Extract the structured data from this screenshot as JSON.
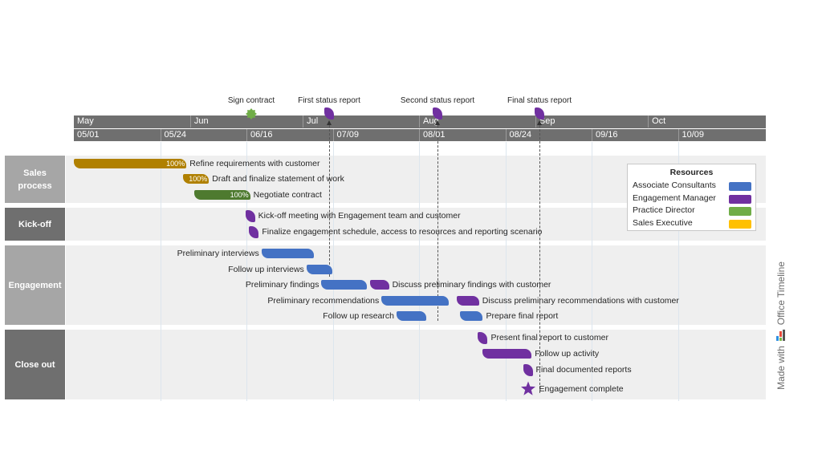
{
  "chart_data": {
    "type": "gantt",
    "title": "",
    "scale": {
      "months": [
        "May",
        "Jun",
        "Jul",
        "Aug",
        "Sep",
        "Oct"
      ],
      "ticks": [
        "05/01",
        "05/24",
        "06/16",
        "07/09",
        "08/01",
        "08/24",
        "09/16",
        "10/09"
      ]
    },
    "milestones_top": [
      {
        "label": "Sign contract",
        "date": "06/17",
        "resource": "Practice Director",
        "shape": "burst"
      },
      {
        "label": "First status report",
        "date": "07/06",
        "resource": "Engagement Manager",
        "shape": "leaf"
      },
      {
        "label": "Second status report",
        "date": "08/01",
        "resource": "Engagement Manager",
        "shape": "leaf"
      },
      {
        "label": "Final status report",
        "date": "08/30",
        "resource": "Engagement Manager",
        "shape": "leaf"
      }
    ],
    "swimlanes": [
      {
        "name": "Sales\nprocess",
        "tasks": [
          {
            "label": "Refine requirements with customer",
            "start": "05/01",
            "end": "05/31",
            "resource": "Sales Executive",
            "percent": "100%"
          },
          {
            "label": "Draft and finalize statement of work",
            "start": "05/30",
            "end": "06/06",
            "resource": "Sales Executive",
            "percent": "100%"
          },
          {
            "label": "Negotiate contract",
            "start": "06/02",
            "end": "06/17",
            "resource": "Practice Director",
            "percent": "100%"
          }
        ]
      },
      {
        "name": "Kick-off",
        "tasks": [
          {
            "label": "Kick-off meeting with Engagement team and customer",
            "start": "06/17",
            "resource": "Engagement Manager",
            "milestone": true
          },
          {
            "label": "Finalize engagement schedule, access to resources and reporting scenario",
            "start": "06/18",
            "resource": "Engagement Manager",
            "milestone": true
          }
        ]
      },
      {
        "name": "Engagement",
        "tasks": [
          {
            "label": "Preliminary interviews",
            "start": "06/20",
            "end": "07/04",
            "resource": "Associate Consultants",
            "label_side": "left"
          },
          {
            "label": "Follow up interviews",
            "start": "07/02",
            "end": "07/09",
            "resource": "Associate Consultants",
            "label_side": "left"
          },
          {
            "label": "Preliminary findings",
            "start": "07/06",
            "end": "07/18",
            "resource": "Associate Consultants",
            "label_side": "left"
          },
          {
            "label": "Discuss preliminary findings with customer",
            "start": "07/19",
            "end": "07/24",
            "resource": "Engagement Manager"
          },
          {
            "label": "Preliminary recommendations",
            "start": "07/22",
            "end": "08/09",
            "resource": "Associate Consultants",
            "label_side": "left"
          },
          {
            "label": "Discuss preliminary recommendations with customer",
            "start": "08/11",
            "end": "08/17",
            "resource": "Engagement Manager"
          },
          {
            "label": "Follow up research",
            "start": "07/26",
            "end": "08/03",
            "resource": "Associate Consultants",
            "label_side": "left"
          },
          {
            "label": "Prepare final report",
            "start": "08/12",
            "end": "08/18",
            "resource": "Associate Consultants"
          }
        ]
      },
      {
        "name": "Close out",
        "tasks": [
          {
            "label": "Present final report to customer",
            "start": "08/18",
            "resource": "Engagement Manager",
            "milestone": true
          },
          {
            "label": "Follow up activity",
            "start": "08/18",
            "end": "08/31",
            "resource": "Engagement Manager"
          },
          {
            "label": "Final documented reports",
            "start": "08/30",
            "resource": "Engagement Manager",
            "milestone": true
          },
          {
            "label": "Engagement complete",
            "start": "08/30",
            "resource": "Engagement Manager",
            "milestone": true,
            "shape": "star"
          }
        ]
      }
    ],
    "legend": {
      "title": "Resources",
      "placement": "right",
      "items": [
        {
          "label": "Associate Consultants",
          "color": "#4472c4"
        },
        {
          "label": "Engagement Manager",
          "color": "#7030a0"
        },
        {
          "label": "Practice Director",
          "color": "#70ad47"
        },
        {
          "label": "Sales Executive",
          "color": "#ffc000"
        }
      ]
    }
  },
  "colors": {
    "sales_bar": "#b08000",
    "practice_bar": "#4e7a2f",
    "consultant_bar": "#4472c4",
    "manager": "#7030a0",
    "sign_contract": "#70ad47",
    "scale_bg": "#6f6f6f"
  },
  "watermark": {
    "made_with": "Made with",
    "brand": "Office Timeline"
  }
}
